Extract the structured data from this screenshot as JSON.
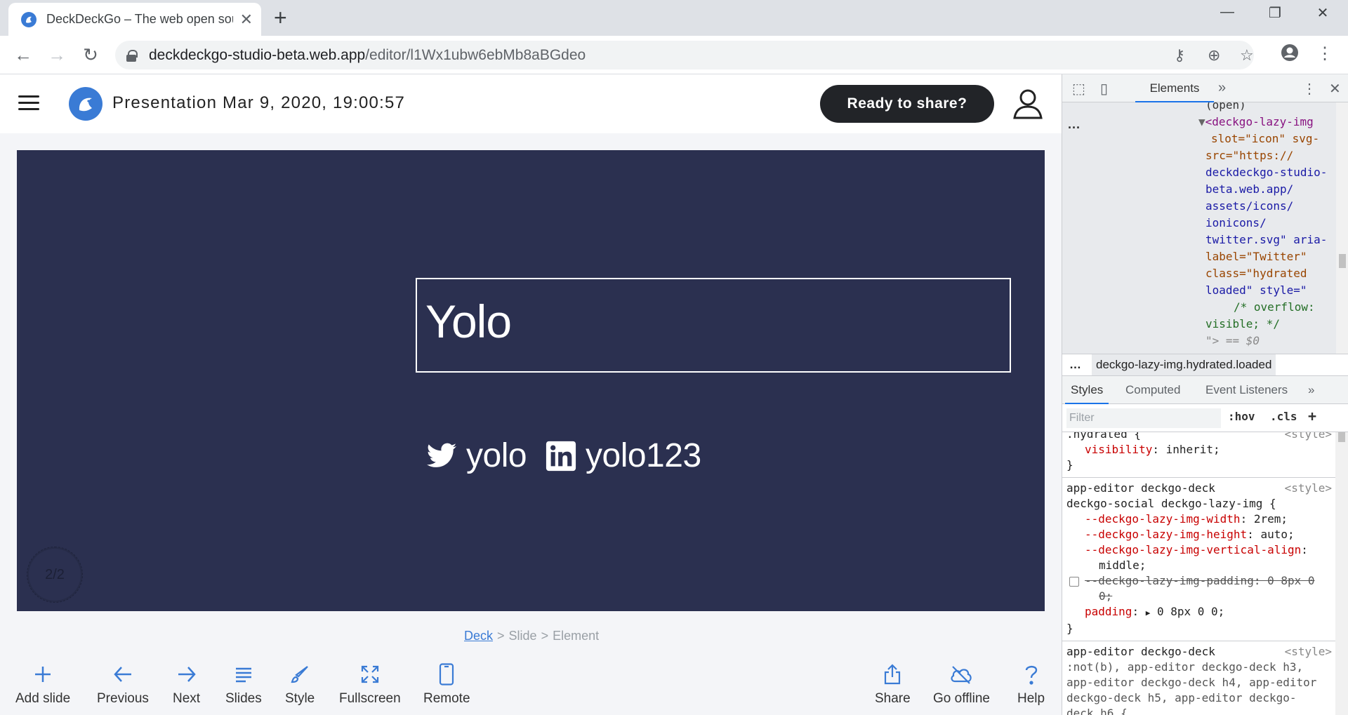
{
  "browser": {
    "tab_title": "DeckDeckGo – The web open source editor for presentations",
    "url_host": "deckdeckgo-studio-beta.web.app",
    "url_path": "/editor/l1Wx1ubw6ebMb8aBGdeo"
  },
  "app": {
    "title": "Presentation Mar 9, 2020, 19:00:57",
    "share_label": "Ready to share?",
    "slide": {
      "title": "Yolo",
      "socials": [
        {
          "icon": "twitter-icon",
          "label": "yolo"
        },
        {
          "icon": "linkedin-icon",
          "label": "yolo123"
        }
      ],
      "pager": "2/2",
      "background": "#2b3050"
    },
    "breadcrumb": [
      "Deck",
      "Slide",
      "Element"
    ],
    "actions_left": [
      {
        "name": "add-slide",
        "label": "Add slide"
      },
      {
        "name": "previous",
        "label": "Previous"
      },
      {
        "name": "next",
        "label": "Next"
      },
      {
        "name": "slides",
        "label": "Slides"
      },
      {
        "name": "style",
        "label": "Style"
      },
      {
        "name": "fullscreen",
        "label": "Fullscreen"
      },
      {
        "name": "remote",
        "label": "Remote"
      }
    ],
    "actions_right": [
      {
        "name": "share",
        "label": "Share"
      },
      {
        "name": "go-offline",
        "label": "Go offline"
      },
      {
        "name": "help",
        "label": "Help"
      }
    ],
    "accent": "#3a7bd5"
  },
  "devtools": {
    "tab_elements": "Elements",
    "dom_lines": [
      "(open)",
      "<deckgo-lazy-img",
      "slot=\"icon\" svg-",
      "src=\"https://",
      "deckdeckgo-studio-",
      "beta.web.app/",
      "assets/icons/",
      "ionicons/",
      "twitter.svg\" aria-",
      "label=\"Twitter\"",
      "class=\"hydrated",
      "loaded\" style=\"",
      "/* overflow:",
      "visible; */",
      "\"> == $0"
    ],
    "crumb": "deckgo-lazy-img.hydrated.loaded",
    "sub_tabs": [
      "Styles",
      "Computed",
      "Event Listeners"
    ],
    "filter_placeholder": "Filter",
    "hov": ":hov",
    "cls": ".cls",
    "rules": {
      "r1_selector": ".hydrated {",
      "r1_prop": "visibility",
      "r1_val": "inherit;",
      "src": "<style>",
      "r2_selector_1": "app-editor deckgo-deck",
      "r2_selector_2": "deckgo-social deckgo-lazy-img {",
      "r2_p1": "--deckgo-lazy-img-width",
      "r2_v1": "2rem;",
      "r2_p2": "--deckgo-lazy-img-height",
      "r2_v2": "auto;",
      "r2_p3": "--deckgo-lazy-img-vertical-align",
      "r2_v3": "middle;",
      "r2_p4": "--deckgo-lazy-img-padding",
      "r2_v4": "0 8px 0",
      "r2_v4b": "0;",
      "r2_p5": "padding",
      "r2_v5": "0 8px 0 0;",
      "r3_l1": "app-editor deckgo-deck",
      "r3_l2": ":not(b), app-editor deckgo-deck h3,",
      "r3_l3": "app-editor deckgo-deck h4, app-editor",
      "r3_l4": "deckgo-deck h5, app-editor deckgo-",
      "r3_l5": "deck h6 {"
    }
  }
}
